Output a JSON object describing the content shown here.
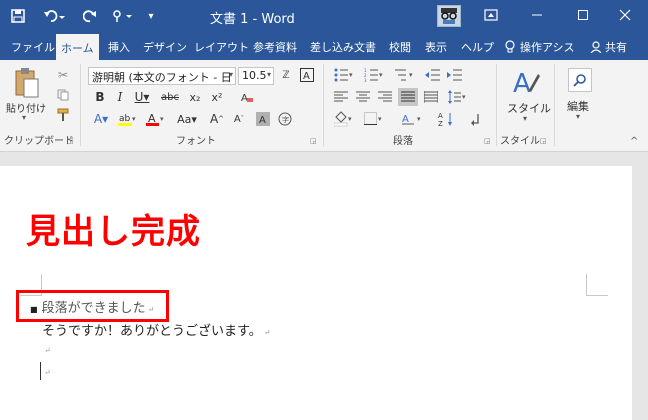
{
  "window": {
    "title": "文書 1  -  Word"
  },
  "tabs": [
    {
      "label": "ファイル",
      "active": false
    },
    {
      "label": "ホーム",
      "active": true
    },
    {
      "label": "挿入",
      "active": false
    },
    {
      "label": "デザイン",
      "active": false
    },
    {
      "label": "レイアウト",
      "active": false
    },
    {
      "label": "参考資料",
      "active": false
    },
    {
      "label": "差し込み文書",
      "active": false
    },
    {
      "label": "校閲",
      "active": false
    },
    {
      "label": "表示",
      "active": false
    },
    {
      "label": "ヘルプ",
      "active": false
    },
    {
      "label": "操作アシス",
      "active": false
    },
    {
      "label": "共有",
      "active": false
    }
  ],
  "ribbon": {
    "clipboard": {
      "paste_label": "貼り付け",
      "group_label": "クリップボード"
    },
    "font": {
      "font_name": "游明朝 (本文のフォント - 日",
      "font_size": "10.5",
      "group_label": "フォント"
    },
    "paragraph": {
      "group_label": "段落"
    },
    "styles": {
      "style_label": "スタイル",
      "group_label": "スタイル"
    },
    "editing": {
      "edit_label": "編集"
    }
  },
  "document": {
    "heading": "見出し完成",
    "lines": [
      "段落ができました",
      "そうですか！ありがとうございます。"
    ],
    "para_mark": "↵"
  },
  "colors": {
    "title_bar": "#2b579a",
    "ribbon": "#f3f3f3",
    "annotation": "#ff0000"
  }
}
